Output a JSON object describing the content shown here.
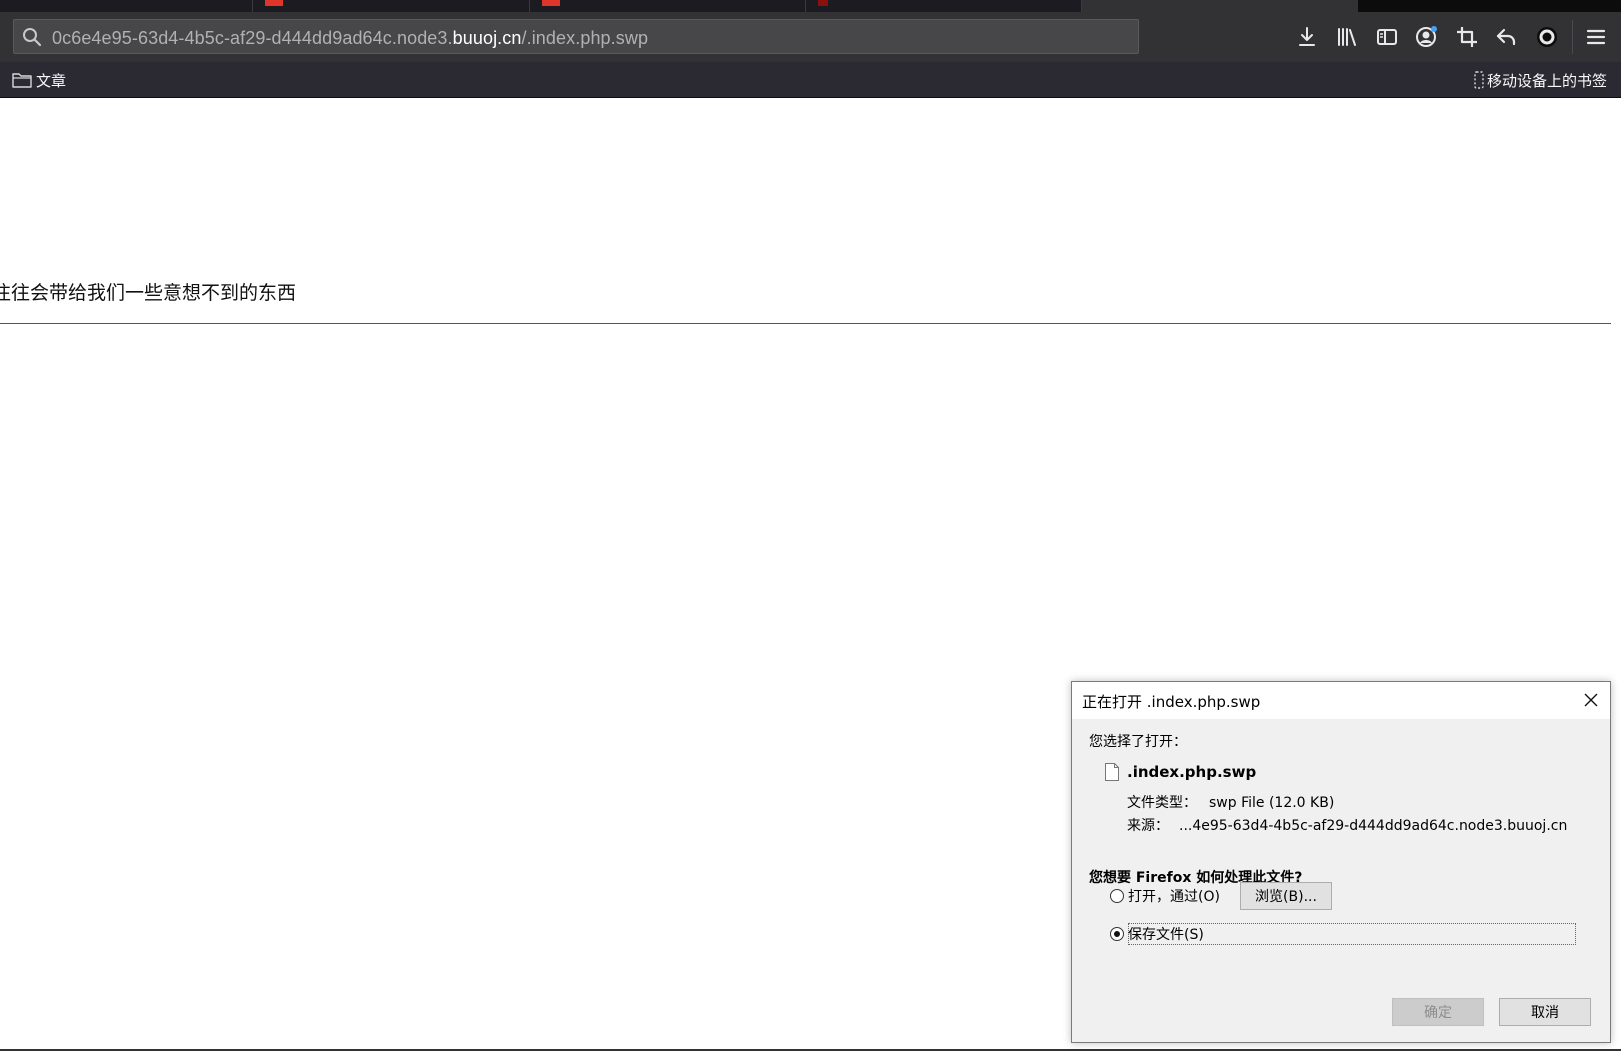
{
  "browser": {
    "url_prefix": "0c6e4e95-63d4-4b5c-af29-d444dd9ad64c.node3.",
    "url_host": "buuoj.cn",
    "url_path": "/.index.php.swp",
    "toolbar_icons": [
      "download-icon",
      "library-icon",
      "sidebar-icon",
      "account-icon",
      "screenshot-icon",
      "undo-icon",
      "circle-extension-icon",
      "hamburger-menu-icon"
    ]
  },
  "bookmarks": {
    "folder_label": "文章",
    "mobile_label": "移动设备上的书签"
  },
  "page": {
    "text": "往往会带给我们一些意想不到的东西"
  },
  "dialog": {
    "title": "正在打开 .index.php.swp",
    "prompt": "您选择了打开：",
    "file_name": ".index.php.swp",
    "type_key": "文件类型：",
    "type_val": "swp File (12.0 KB)",
    "source_key": "来源：",
    "source_val": "...4e95-63d4-4b5c-af29-d444dd9ad64c.node3.buuoj.cn",
    "question": "您想要 Firefox 如何处理此文件?",
    "open_with_label": "打开，通过(O)",
    "browse_label": "浏览(B)...",
    "save_label": "保存文件(S)",
    "ok_label": "确定",
    "cancel_label": "取消",
    "selected_option": "save"
  }
}
